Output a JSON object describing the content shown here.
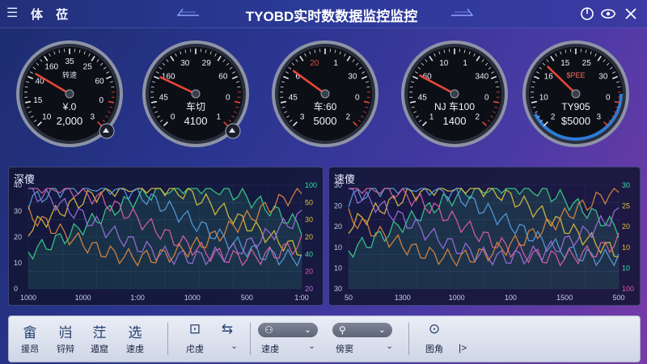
{
  "header": {
    "menu_icon": "menu-icon",
    "app_name": "体 莅",
    "title": "TYOBD实时数数据监控监控",
    "colors": {
      "bar": "#2c3a9a",
      "accent": "#e8473a"
    }
  },
  "gauges": [
    {
      "ticks": [
        "10",
        "15",
        "40",
        "160",
        "35",
        "25",
        "60",
        "0",
        "3"
      ],
      "unit": "转速",
      "readout": "¥.0",
      "value": "2,000",
      "needle_fraction": 0.28,
      "badge": "gauge-icon"
    },
    {
      "ticks": [
        "0",
        "45",
        "160",
        "30",
        "29",
        "60",
        "0",
        "1"
      ],
      "unit": "",
      "readout": "车切",
      "value": "4100",
      "needle_fraction": 0.26,
      "badge": "gauge-icon"
    },
    {
      "ticks": [
        "3",
        "45",
        "6",
        "20",
        "1",
        "30",
        "0",
        "2"
      ],
      "unit": "",
      "readout": "车:60",
      "value": "5000",
      "needle_fraction": 0.3,
      "badge": ""
    },
    {
      "ticks": [
        "1",
        "45",
        "60",
        "10",
        "1",
        "340",
        "0",
        "2"
      ],
      "unit": "",
      "readout": "车100",
      "value": "1400",
      "needle_fraction": 0.27,
      "badge": "",
      "prefix": "NJ"
    },
    {
      "ticks": [
        "2",
        "10",
        "16",
        "15",
        "25",
        "30",
        "0",
        "3"
      ],
      "unit": "$PEE",
      "readout": "TY905",
      "value": "$5000",
      "needle_fraction": 0.33,
      "badge": ""
    }
  ],
  "left_panel": {
    "title": "深傻",
    "y_ticks": [
      "40",
      "30",
      "20",
      "10",
      "0"
    ],
    "x_ticks": [
      "1000",
      "1000",
      "1:00",
      "1000",
      "500",
      "1:00"
    ],
    "right_ticks": [
      "100",
      "50",
      "30",
      "20",
      "40",
      "20",
      "20"
    ],
    "legend": [
      "",
      ""
    ]
  },
  "right_panel": {
    "title": "速傻",
    "y_ticks": [
      "30",
      "20",
      "20",
      "10",
      "10",
      "30"
    ],
    "x_ticks": [
      "50",
      "1300",
      "1000",
      "100",
      "1500",
      "500"
    ],
    "right_ticks": [
      "30",
      "25",
      "20",
      "10",
      "10",
      "100"
    ]
  },
  "toolbar": {
    "items": [
      {
        "glyph": "畲",
        "label": "援昂"
      },
      {
        "glyph": "岿",
        "label": "锊辩"
      },
      {
        "glyph": "茳",
        "label": "遁窟"
      },
      {
        "glyph": "选",
        "label": "速虔"
      }
    ],
    "items2": [
      {
        "glyph": "⊡",
        "label": "虍虔"
      },
      {
        "glyph": "⇆",
        "label": ""
      }
    ],
    "dropdown1": {
      "label": "速虔"
    },
    "dropdown2": {
      "label": "傍窦"
    },
    "settings_label": "图角",
    "play_label": "|>"
  }
}
